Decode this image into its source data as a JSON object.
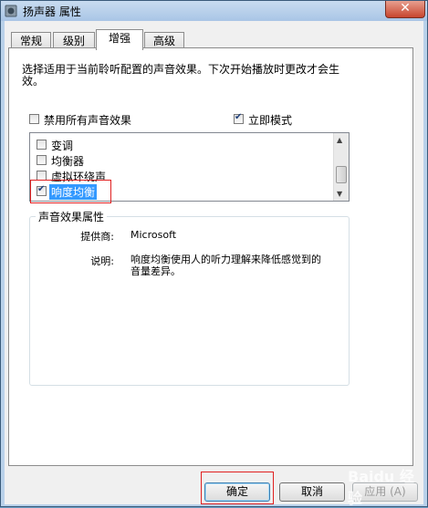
{
  "window": {
    "title": "扬声器 属性",
    "close_glyph": "✕"
  },
  "tabs": [
    {
      "label": "常规"
    },
    {
      "label": "级别"
    },
    {
      "label": "增强"
    },
    {
      "label": "高级"
    }
  ],
  "active_tab": "增强",
  "description": "选择适用于当前聆听配置的声音效果。下次开始播放时更改才会生效。",
  "disable_all": {
    "label": "禁用所有声音效果",
    "checked": false
  },
  "immediate_mode": {
    "label": "立即模式",
    "checked": true
  },
  "effects": [
    {
      "label": "变调",
      "checked": false
    },
    {
      "label": "均衡器",
      "checked": false
    },
    {
      "label": "虚拟环绕声",
      "checked": false
    },
    {
      "label": "响度均衡",
      "checked": true,
      "selected": true
    }
  ],
  "properties": {
    "title": "声音效果属性",
    "provider_label": "提供商:",
    "provider_value": "Microsoft",
    "desc_label": "说明:",
    "desc_value_line1": "响度均衡使用人的听力理解来降低感觉到的",
    "desc_value_line2": "音量差异。"
  },
  "buttons": {
    "ok": "确定",
    "cancel": "取消",
    "apply": "应用 (A)"
  },
  "watermark": "Baidu 经验",
  "colors": {
    "selection": "#3399ff",
    "highlight_box": "#e02020"
  }
}
